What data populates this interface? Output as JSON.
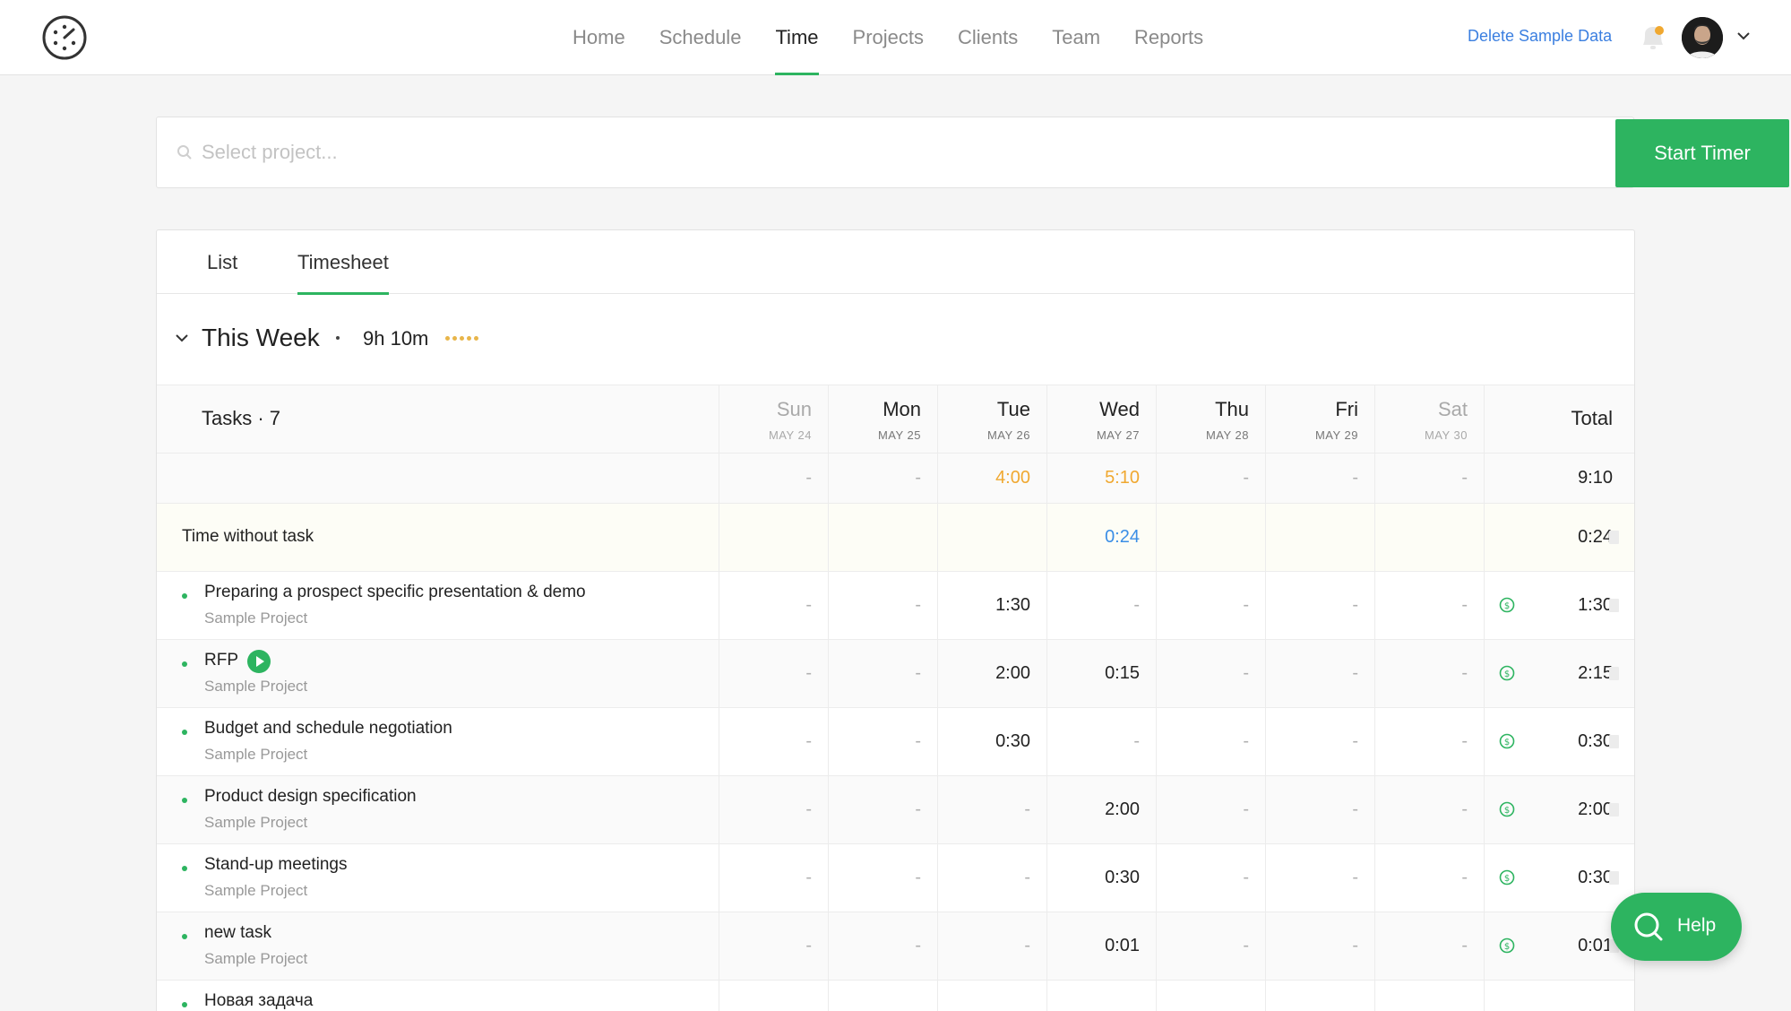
{
  "nav": {
    "items": [
      {
        "label": "Home",
        "active": false
      },
      {
        "label": "Schedule",
        "active": false
      },
      {
        "label": "Time",
        "active": true
      },
      {
        "label": "Projects",
        "active": false
      },
      {
        "label": "Clients",
        "active": false
      },
      {
        "label": "Team",
        "active": false
      },
      {
        "label": "Reports",
        "active": false
      }
    ],
    "delete_sample": "Delete Sample Data"
  },
  "search": {
    "placeholder": "Select project...",
    "value": "",
    "start_timer": "Start Timer"
  },
  "tabs": [
    {
      "label": "List",
      "active": false
    },
    {
      "label": "Timesheet",
      "active": true
    }
  ],
  "week": {
    "title": "This Week",
    "separator": "·",
    "total": "9h 10m"
  },
  "table": {
    "tasks_label": "Tasks · 7",
    "total_label": "Total",
    "days": [
      {
        "name": "Sun",
        "date": "MAY 24",
        "muted": true
      },
      {
        "name": "Mon",
        "date": "MAY 25",
        "muted": false
      },
      {
        "name": "Tue",
        "date": "MAY 26",
        "muted": false
      },
      {
        "name": "Wed",
        "date": "MAY 27",
        "muted": false
      },
      {
        "name": "Thu",
        "date": "MAY 28",
        "muted": false,
        "today": true
      },
      {
        "name": "Fri",
        "date": "MAY 29",
        "muted": false
      },
      {
        "name": "Sat",
        "date": "MAY 30",
        "muted": true
      }
    ],
    "summary": {
      "values": [
        "-",
        "-",
        "4:00",
        "5:10",
        "-",
        "-",
        "-"
      ],
      "total": "9:10"
    },
    "no_task": {
      "label": "Time without task",
      "values": [
        "",
        "",
        "",
        "0:24",
        "",
        "",
        ""
      ],
      "total": "0:24"
    },
    "tasks": [
      {
        "name": "Preparing a prospect specific presentation & demo",
        "project": "Sample Project",
        "values": [
          "-",
          "-",
          "1:30",
          "-",
          "-",
          "-",
          "-"
        ],
        "total": "1:30",
        "running": false
      },
      {
        "name": "RFP",
        "project": "Sample Project",
        "values": [
          "-",
          "-",
          "2:00",
          "0:15",
          "-",
          "-",
          "-"
        ],
        "total": "2:15",
        "running": true
      },
      {
        "name": "Budget and schedule negotiation",
        "project": "Sample Project",
        "values": [
          "-",
          "-",
          "0:30",
          "-",
          "-",
          "-",
          "-"
        ],
        "total": "0:30",
        "running": false
      },
      {
        "name": "Product design specification",
        "project": "Sample Project",
        "values": [
          "-",
          "-",
          "-",
          "2:00",
          "-",
          "-",
          "-"
        ],
        "total": "2:00",
        "running": false
      },
      {
        "name": "Stand-up meetings",
        "project": "Sample Project",
        "values": [
          "-",
          "-",
          "-",
          "0:30",
          "-",
          "-",
          "-"
        ],
        "total": "0:30",
        "running": false
      },
      {
        "name": "new task",
        "project": "Sample Project",
        "values": [
          "-",
          "-",
          "-",
          "0:01",
          "-",
          "-",
          "-"
        ],
        "total": "0:01",
        "running": false
      },
      {
        "name": "Новая задача",
        "project": "",
        "values": [
          "",
          "",
          "",
          "",
          "",
          "",
          ""
        ],
        "total": "",
        "running": false
      }
    ]
  },
  "help": {
    "label": "Help"
  },
  "colors": {
    "accent": "#2db460",
    "link": "#3b7fe0",
    "highlight": "#f0a830",
    "notice": "#f0a830"
  }
}
